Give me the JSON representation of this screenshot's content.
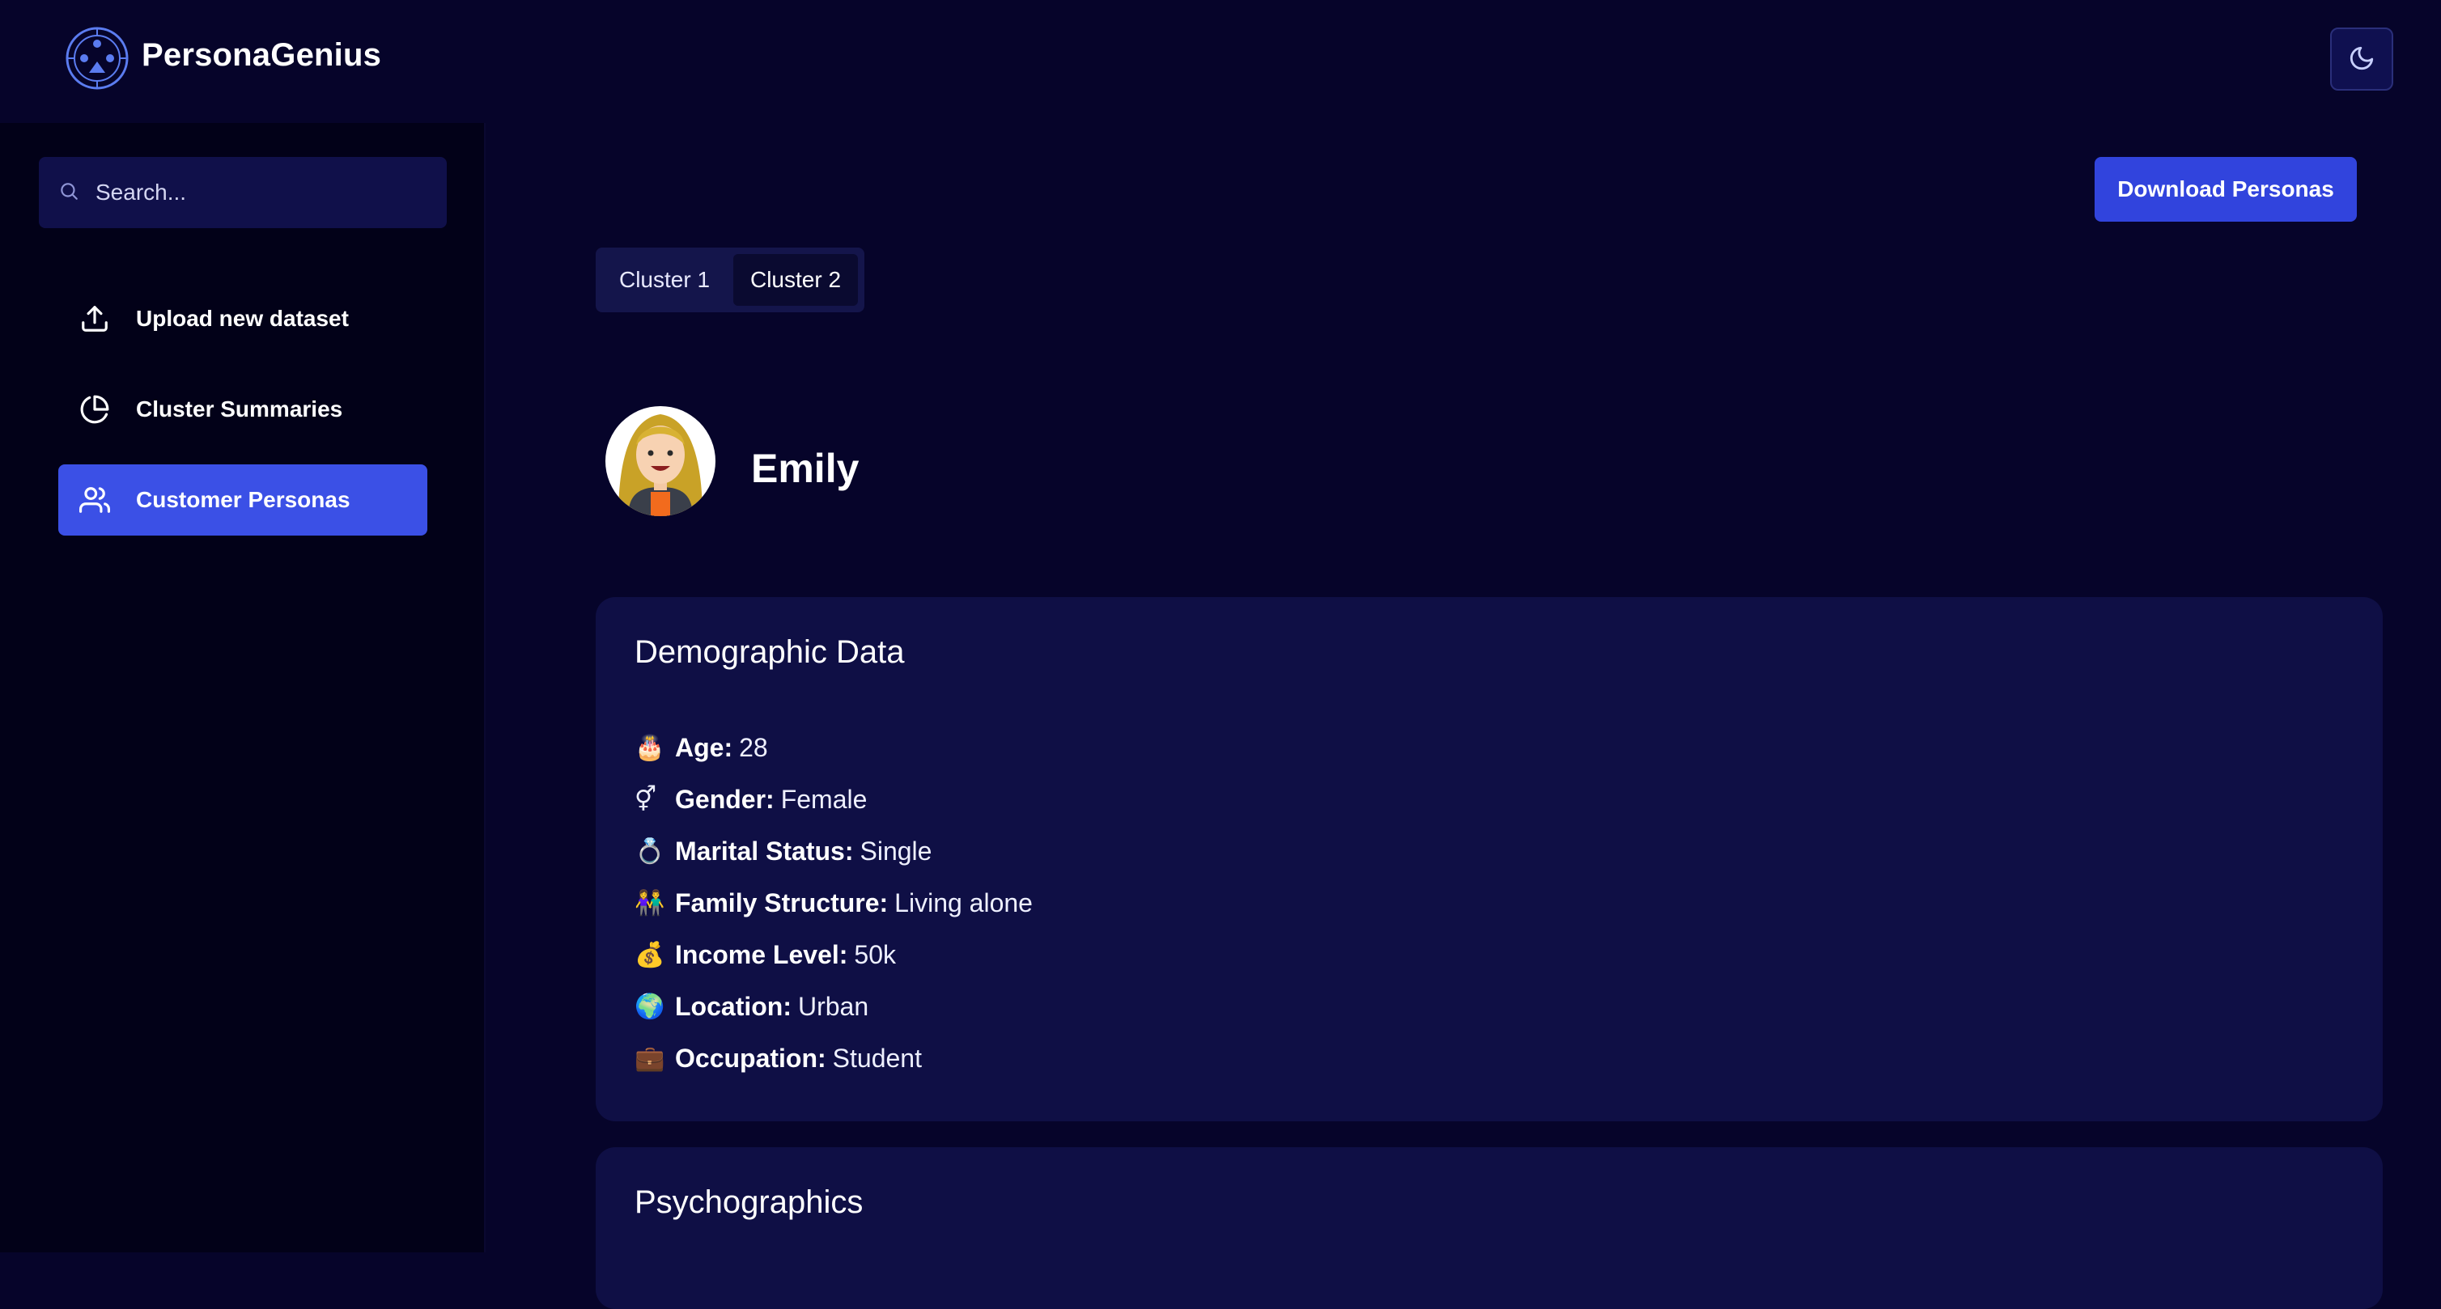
{
  "app": {
    "brand": "PersonaGenius"
  },
  "search": {
    "placeholder": "Search..."
  },
  "sidebar": {
    "items": [
      {
        "label": "Upload new dataset",
        "icon": "upload-icon",
        "active": false
      },
      {
        "label": "Cluster Summaries",
        "icon": "pie-chart-icon",
        "active": false
      },
      {
        "label": "Customer Personas",
        "icon": "users-icon",
        "active": true
      }
    ]
  },
  "toolbar": {
    "download_label": "Download Personas",
    "theme_icon": "moon-icon"
  },
  "tabs": [
    {
      "label": "Cluster 1",
      "selected": false
    },
    {
      "label": "Cluster 2",
      "selected": true
    }
  ],
  "persona": {
    "name": "Emily"
  },
  "demographic": {
    "title": "Demographic Data",
    "rows": [
      {
        "emoji": "🎂",
        "key": "Age:",
        "value": "28"
      },
      {
        "emoji": "⚥",
        "key": "Gender:",
        "value": "Female"
      },
      {
        "emoji": "💍",
        "key": "Marital Status:",
        "value": "Single"
      },
      {
        "emoji": "👫",
        "key": "Family Structure:",
        "value": "Living alone"
      },
      {
        "emoji": "💰",
        "key": "Income Level:",
        "value": "50k"
      },
      {
        "emoji": "🌍",
        "key": "Location:",
        "value": "Urban"
      },
      {
        "emoji": "💼",
        "key": "Occupation:",
        "value": "Student"
      }
    ]
  },
  "psychographics": {
    "title": "Psychographics"
  },
  "colors": {
    "background": "#06042a",
    "sidebar": "#020118",
    "card": "#0f0f45",
    "accent": "#3b50e6"
  }
}
